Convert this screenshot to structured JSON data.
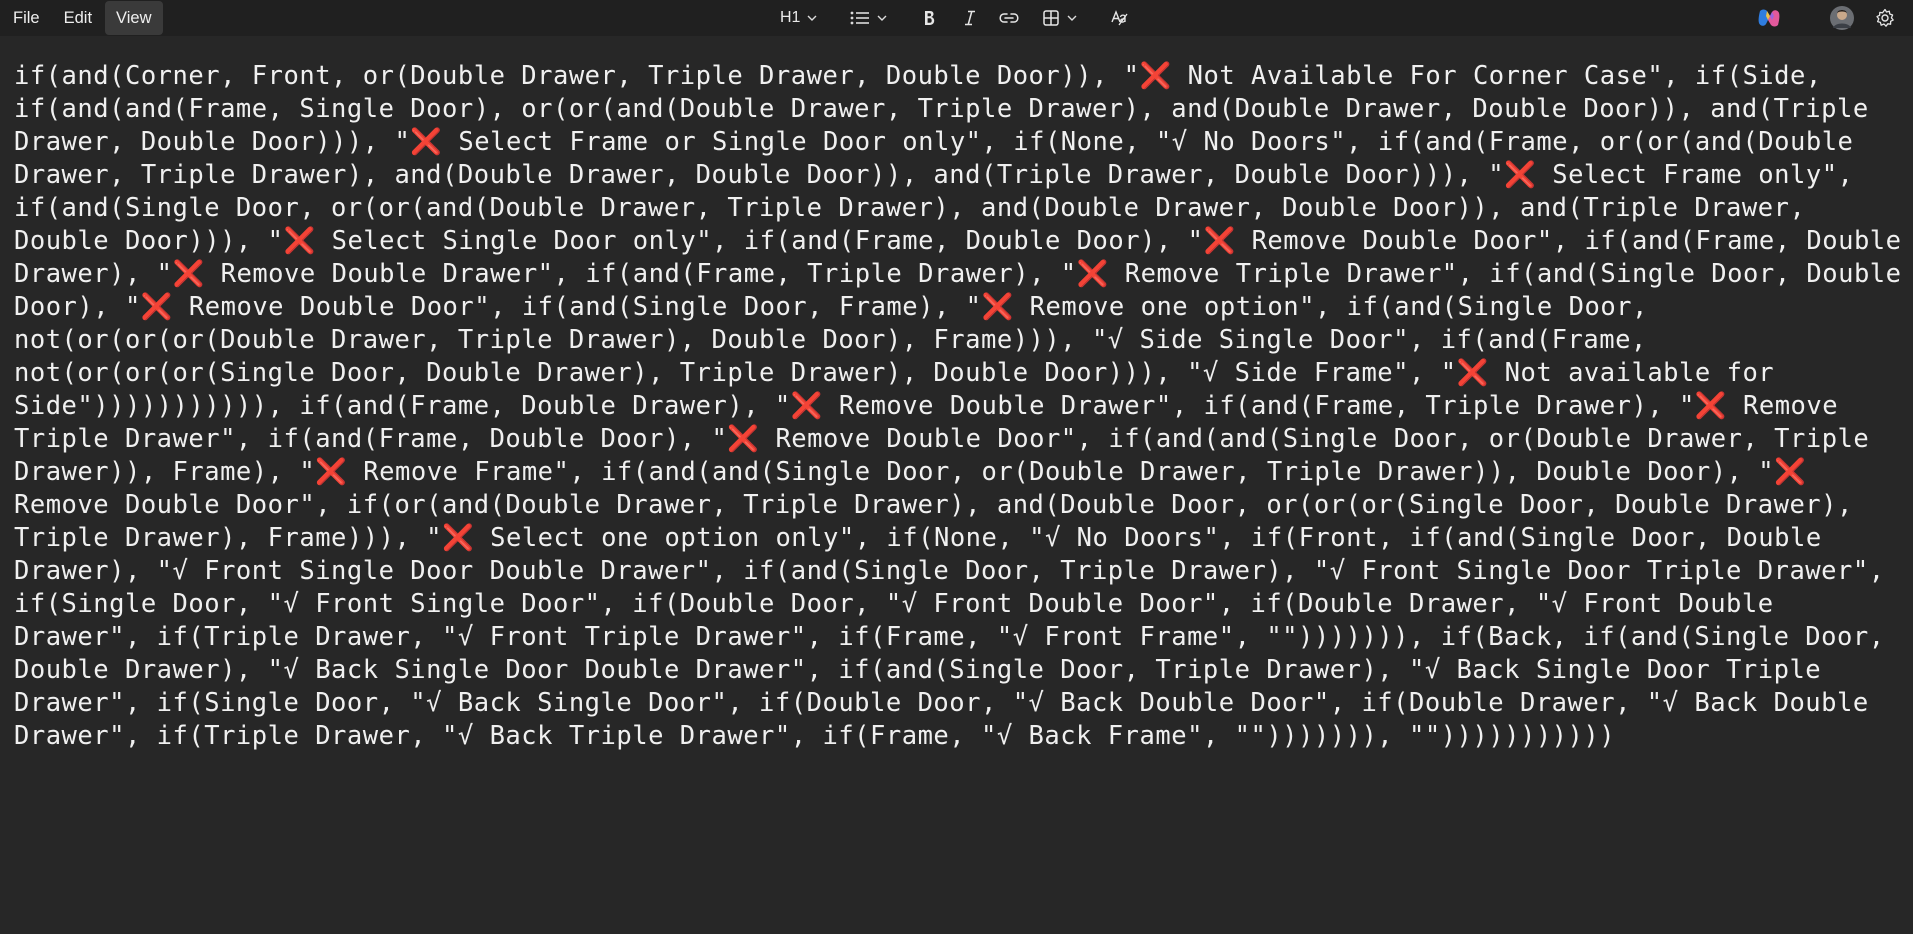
{
  "menu": {
    "file_label": "File",
    "edit_label": "Edit",
    "view_label": "View",
    "active": "View"
  },
  "format_toolbar": {
    "heading_label": "H1",
    "icons": [
      "heading-dropdown",
      "list-icon",
      "bold-icon",
      "italic-icon",
      "link-icon",
      "table-icon",
      "spellcheck-icon"
    ]
  },
  "header_right": {
    "icons": [
      "copilot-icon",
      "avatar",
      "settings-icon"
    ]
  },
  "colors": {
    "background": "#272727",
    "toolbar": "#202020",
    "text": "#f0f0f0",
    "cross_mark": "#e0245e"
  },
  "document": {
    "content": "if(and(Corner, Front, or(Double Drawer, Triple Drawer, Double Door)), \"❌ Not Available For Corner Case\", if(Side, if(and(and(Frame, Single Door), or(or(and(Double Drawer, Triple Drawer), and(Double Drawer, Double Door)), and(Triple Drawer, Double Door))), \"❌ Select Frame or Single Door only\", if(None, \"√ No Doors\", if(and(Frame, or(or(and(Double Drawer, Triple Drawer), and(Double Drawer, Double Door)), and(Triple Drawer, Double Door))), \"❌ Select Frame only\", if(and(Single Door, or(or(and(Double Drawer, Triple Drawer), and(Double Drawer, Double Door)), and(Triple Drawer, Double Door))), \"❌ Select Single Door only\", if(and(Frame, Double Door), \"❌ Remove Double Door\", if(and(Frame, Double Drawer), \"❌ Remove Double Drawer\", if(and(Frame, Triple Drawer), \"❌ Remove Triple Drawer\", if(and(Single Door, Double Door), \"❌ Remove Double Door\", if(and(Single Door, Frame), \"❌ Remove one option\", if(and(Single Door, not(or(or(or(Double Drawer, Triple Drawer), Double Door), Frame))), \"√ Side Single Door\", if(and(Frame, not(or(or(or(Single Door, Double Drawer), Triple Drawer), Double Door))), \"√ Side Frame\", \"❌ Not available for Side\"))))))))))), if(and(Frame, Double Drawer), \"❌ Remove Double Drawer\", if(and(Frame, Triple Drawer), \"❌ Remove Triple Drawer\", if(and(Frame, Double Door), \"❌ Remove Double Door\", if(and(and(Single Door, or(Double Drawer, Triple Drawer)), Frame), \"❌ Remove Frame\", if(and(and(Single Door, or(Double Drawer, Triple Drawer)), Double Door), \"❌ Remove Double Door\", if(or(and(Double Drawer, Triple Drawer), and(Double Door, or(or(or(Single Door, Double Drawer), Triple Drawer), Frame))), \"❌ Select one option only\", if(None, \"√ No Doors\", if(Front, if(and(Single Door, Double Drawer), \"√ Front Single Door Double Drawer\", if(and(Single Door, Triple Drawer), \"√ Front Single Door Triple Drawer\", if(Single Door, \"√ Front Single Door\", if(Double Door, \"√ Front Double Door\", if(Double Drawer, \"√ Front Double Drawer\", if(Triple Drawer, \"√ Front Triple Drawer\", if(Frame, \"√ Front Frame\", \"\"))))))), if(Back, if(and(Single Door, Double Drawer), \"√ Back Single Door Double Drawer\", if(and(Single Door, Triple Drawer), \"√ Back Single Door Triple Drawer\", if(Single Door, \"√ Back Single Door\", if(Double Door, \"√ Back Double Door\", if(Double Drawer, \"√ Back Double Drawer\", if(Triple Drawer, \"√ Back Triple Drawer\", if(Frame, \"√ Back Frame\", \"\"))))))), \"\")))))))))))"
  }
}
